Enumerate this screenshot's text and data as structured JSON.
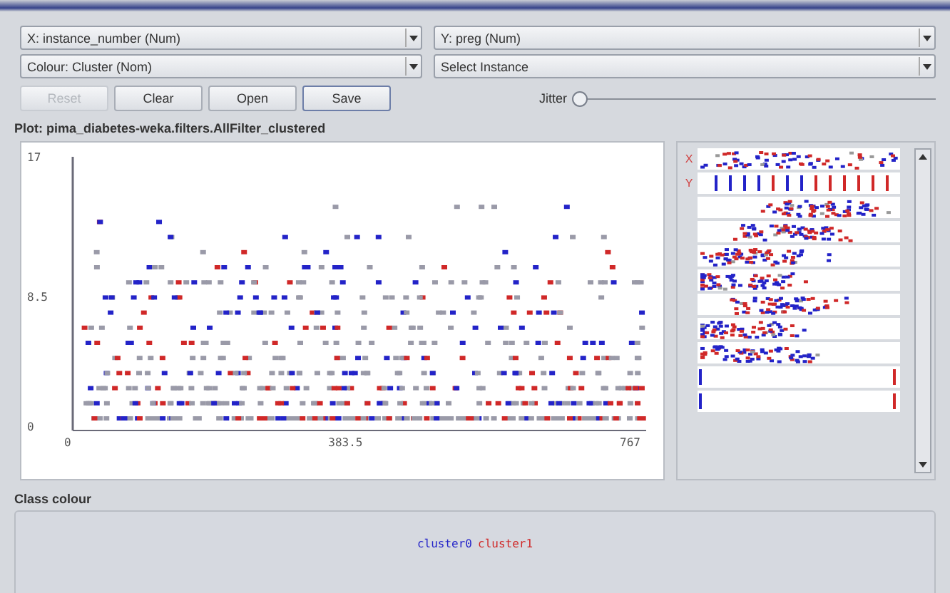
{
  "selectors": [
    {
      "label": "X: instance_number (Num)"
    },
    {
      "label": "Y: preg (Num)"
    },
    {
      "label": "Colour: Cluster (Nom)"
    },
    {
      "label": "Select Instance"
    }
  ],
  "buttons": [
    {
      "label": "Reset",
      "disabled": true
    },
    {
      "label": "Clear",
      "disabled": false
    },
    {
      "label": "Open",
      "disabled": false
    },
    {
      "label": "Save",
      "disabled": false
    }
  ],
  "jitter": {
    "label": "Jitter",
    "level": 0
  },
  "plot": {
    "title": "Plot: pima_diabetes-weka.filters.AllFilter_clustered",
    "y_ticks": [
      "17",
      "8.5",
      "0"
    ],
    "x_ticks": [
      "0",
      "383.5",
      "767"
    ]
  },
  "attribute_strips": {
    "x_mark": "X",
    "y_mark": "Y"
  },
  "class_colour": {
    "title": "Class colour",
    "classes": [
      {
        "label": "cluster0",
        "color": "#2323c8"
      },
      {
        "label": "cluster1",
        "color": "#d02828"
      }
    ]
  }
}
